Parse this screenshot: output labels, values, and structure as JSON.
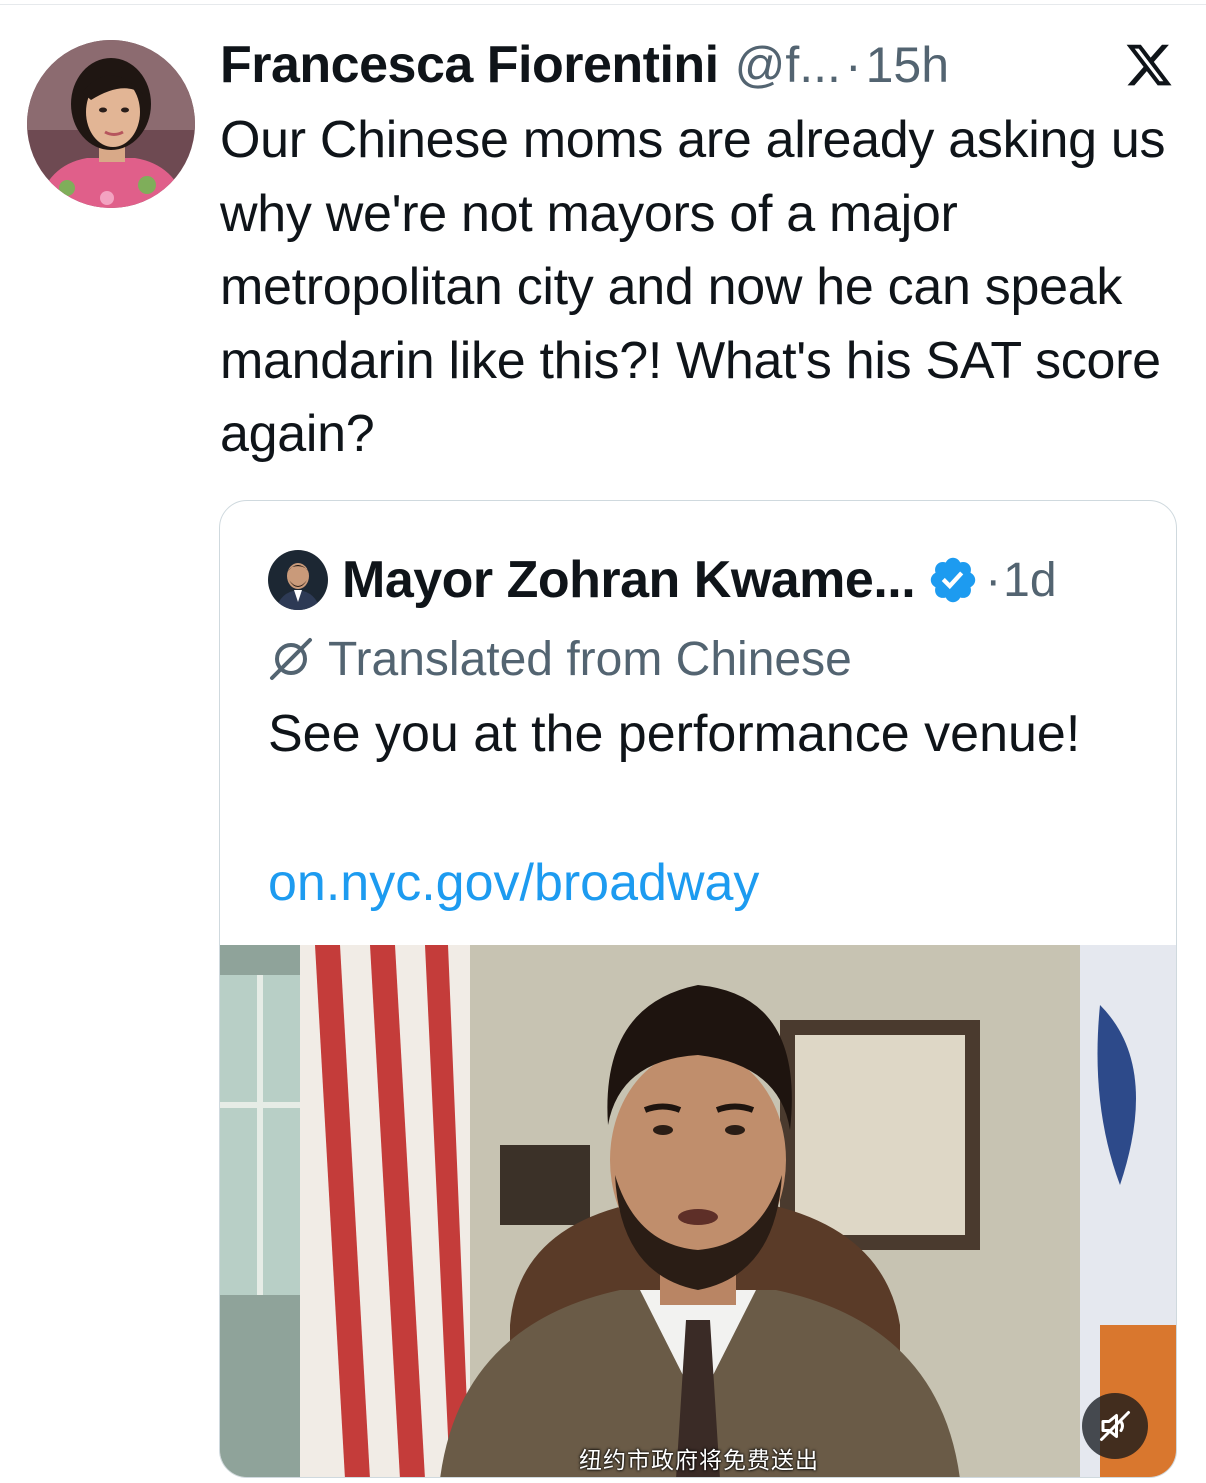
{
  "tweet": {
    "author_name": "Francesca Fiorentini",
    "author_handle": "@f...",
    "separator": "·",
    "time": "15h",
    "text": "Our Chinese moms are already asking us why we're not mayors of a major metropolitan city and now he can speak mandarin like this?! What's his SAT score again?",
    "avatar_icon": "user-avatar-photo",
    "platform_icon": "x-logo-icon"
  },
  "quoted_tweet": {
    "author_name": "Mayor Zohran Kwame...",
    "verified_icon": "verified-badge-icon",
    "separator": "·",
    "time": "1d",
    "translated_label": "Translated from Chinese",
    "translate_icon": "translate-icon",
    "text": "See you at the performance venue!",
    "link": "on.nyc.gov/broadway",
    "video": {
      "subtitle": "纽约市政府将免费送出",
      "mute_icon": "muted-speaker-icon"
    }
  },
  "colors": {
    "text_primary": "#0f1419",
    "text_secondary": "#536471",
    "link": "#1d9bf0",
    "border": "#cfd9de",
    "verified": "#1d9bf0"
  }
}
